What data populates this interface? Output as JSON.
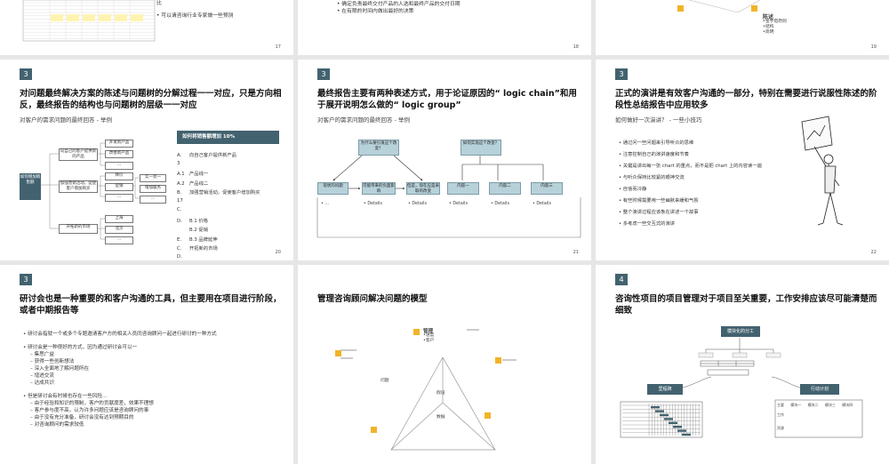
{
  "slide1": {
    "bullet_top": "比",
    "bullet": "可以请咨询行业专家做一些预测",
    "page": "17"
  },
  "slide2": {
    "bullets": [
      "确定负责最终交付产品的人选和最终产品的交付日期",
      "在有限的时间内做出最好的决策"
    ],
    "page": "18"
  },
  "slide3": {
    "label": "陈述",
    "items": [
      "•金字塔原则",
      "•结构",
      "•简明"
    ],
    "page": "19"
  },
  "slide4": {
    "num": "3",
    "title": "对问题最终解决方案的陈述与问题树的分解过程一一对应，只是方向相反，最终报告的结构也与问题树的层级一一对应",
    "subtitle": "对客户的需求问题的最终回答 - 举例",
    "root": "如何增加销售额",
    "mid": [
      "向自己的客户提供新的产品",
      "加强营销活动，促使客户增加购买",
      "开拓新的市场"
    ],
    "leaves": [
      "开发新产品",
      "改善新产品",
      "…",
      "降价",
      "促销",
      "…",
      "上海",
      "北京",
      "…"
    ],
    "leaf2": [
      "实一装一",
      "增加服务",
      "…"
    ],
    "header": "如何将销售额增加 10%",
    "items": [
      {
        "k": "A.",
        "t": "向自己客户提供新产品"
      },
      {
        "k": "3",
        "t": ""
      },
      {
        "k": "A.1",
        "t": "产品线一"
      },
      {
        "k": "A.2",
        "t": "产品线二"
      },
      {
        "k": "B.",
        "t": "加强营销活动，促使客户增加购买"
      },
      {
        "k": "17",
        "t": ""
      },
      {
        "k": "C.",
        "t": ""
      },
      {
        "k": "D.",
        "t": "B.1 价格"
      },
      {
        "k": "",
        "t": "B.2 促销"
      },
      {
        "k": "E.",
        "t": "B.3 品牌延伸"
      },
      {
        "k": "C.",
        "t": "开拓新的市场"
      },
      {
        "k": "D.",
        "t": ""
      }
    ],
    "page": "20"
  },
  "slide5": {
    "num": "3",
    "title": "最终报告主要有两种表述方式，用于论证原因的“ logic chain”和用于展开说明怎么做的“ logic group”",
    "subtitle": "对客户的需求问题的最终回答 - 举例",
    "q1": "为什么要引发这个改变？",
    "q2": "如何实现这个改变？",
    "chain": [
      "现状的问题",
      "可能带来的负面影响",
      "但是，现在应是采取的改变"
    ],
    "group": [
      "内容一",
      "内容二",
      "内容三"
    ],
    "details": [
      "…",
      "Details",
      "Details",
      "Details",
      "Details",
      "Details"
    ],
    "page": "21"
  },
  "slide6": {
    "num": "3",
    "title": "正式的演讲是有效客户沟通的一部分，特别在需要进行说服性陈述的阶段性总结报告中应用较多",
    "subtitle": "如何做好一次演讲？  - 一些小技巧",
    "bullets": [
      "通过问一些问题来引导听众的思维",
      "注意控制自己的演讲速度和节奏",
      "关键是讲出每一张 chart 的重点，而不是把 chart 上的内容读一遍",
      "与听众保持比较紧的眼神交流",
      "自信而冷静",
      "有些时候需要用一些幽默来缓和气氛",
      "整个演讲过程应该象在讲述一个故事",
      "多考虑一些交互式的演讲"
    ],
    "page": "22"
  },
  "slide7": {
    "num": "3",
    "title": "研讨会也是一种重要的和客户沟通的工具，但主要用在项目进行阶段，或者中期报告等",
    "bullets": [
      "研讨会指就一个或多个专题邀请客户方的相关人员同咨询顾问一起进行研讨的一种方式",
      "研讨会是一种很好的方式，因为通过研讨会可以一",
      "– 集思广益",
      "– 获得一些创新想法",
      "– 深入全面地了解问题所在",
      "– 增进交流",
      "– 达成共识",
      "但是研讨会有时候也存在一些风险…",
      "– 由于经验和知识的限制，客户的贡献度差，效果不理想",
      "– 客户参与度不高，认为许多问题应该是咨询顾问的事",
      "– 由于没有充分准备，研讨会没有达到预期目的",
      "– 对咨询顾问的需求较低"
    ]
  },
  "slide8": {
    "title": "管理咨询顾问解决问题的模型",
    "top_label": "管理",
    "top_items": [
      "•进度",
      "•客户"
    ],
    "left": "问题",
    "center": "假设",
    "bottom": "数据"
  },
  "slide9": {
    "num": "4",
    "title": "咨询性项目的项目管理对于项目至关重要，工作安排应该尽可能清楚而细致",
    "top": "模块化的分工",
    "left": "里程碑",
    "right": "行动计划",
    "right_cols": [
      "主要",
      "模块一",
      "模块二",
      "模块三",
      "模块四"
    ],
    "right_rows": [
      "工作",
      "资源"
    ]
  }
}
